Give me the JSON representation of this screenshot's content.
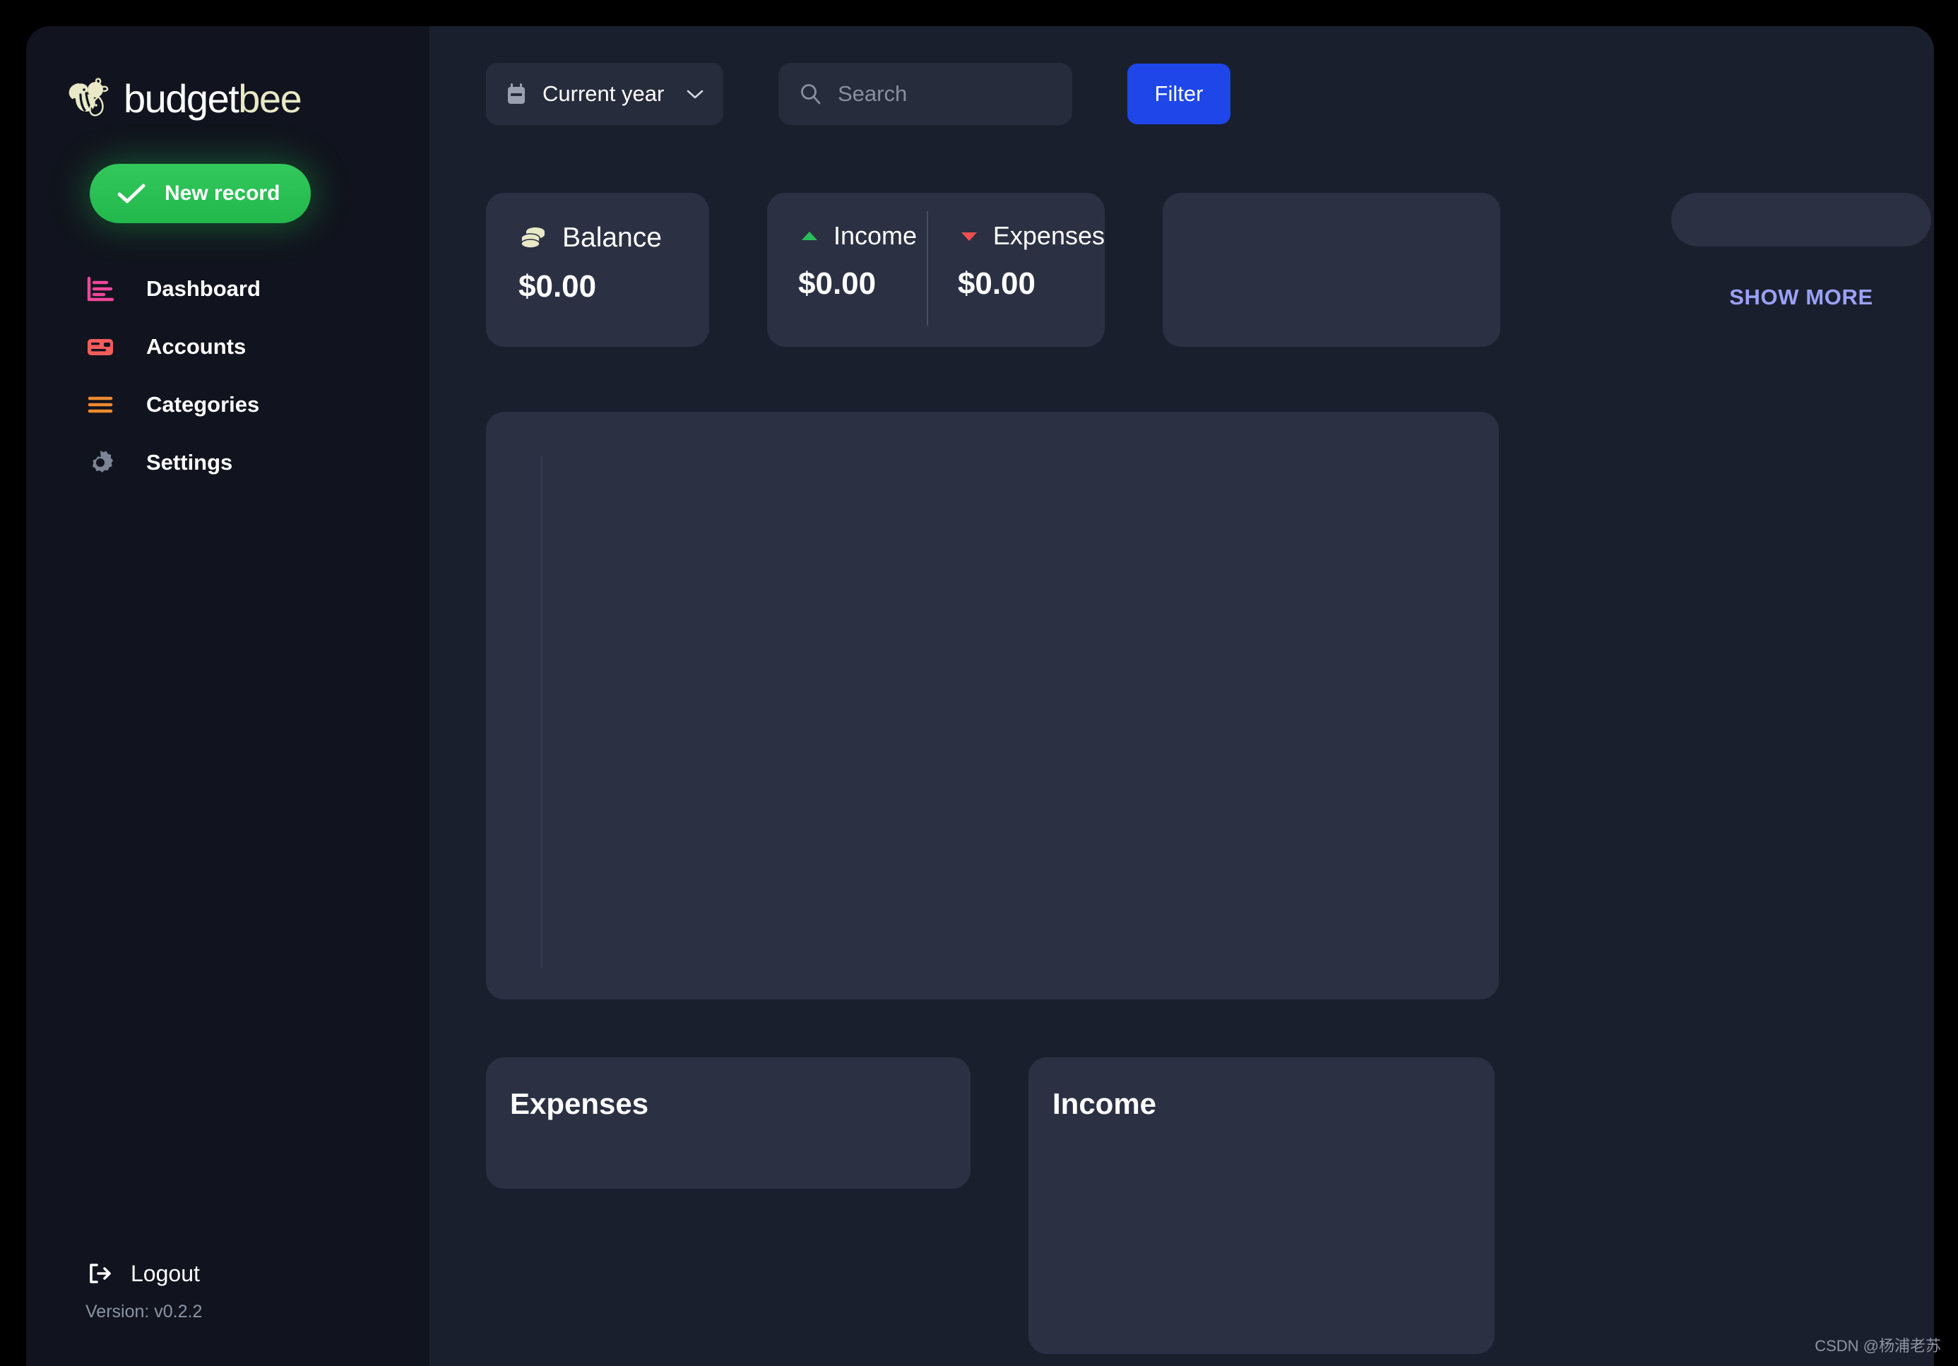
{
  "app": {
    "brand_first": "budget",
    "brand_second": "bee",
    "bee_icon": "bee-icon",
    "accent_green": "#22B84C",
    "accent_blue": "#1E46E8",
    "accent_lavender": "#9BA1F7",
    "brand_cream": "#E9E9C7",
    "background": "#1A1F2E",
    "sidebar_background": "#11141E",
    "card_background": "#2B3043"
  },
  "sidebar": {
    "new_record_label": "New record",
    "new_record_icon": "check-icon",
    "items": [
      {
        "label": "Dashboard",
        "icon": "bar-chart-icon",
        "color": "#F0479B"
      },
      {
        "label": "Accounts",
        "icon": "credit-card-icon",
        "color": "#F25C5C"
      },
      {
        "label": "Categories",
        "icon": "list-lines-icon",
        "color": "#F08A2E"
      },
      {
        "label": "Settings",
        "icon": "gear-icon",
        "color": "#7C8496"
      }
    ],
    "logout_label": "Logout",
    "logout_icon": "logout-icon",
    "version_label": "Version: v0.2.2"
  },
  "toolbar": {
    "period_value": "Current year",
    "period_icon": "calendar-icon",
    "period_chevron": "chevron-down-icon",
    "search_placeholder": "Search",
    "search_value": "",
    "search_icon": "search-icon",
    "filter_label": "Filter"
  },
  "stats": {
    "balance": {
      "title": "Balance",
      "icon": "coins-icon",
      "amount": "$0.00"
    },
    "income": {
      "title": "Income",
      "icon": "triangle-up-icon",
      "icon_color": "#2BBD5B",
      "amount": "$0.00"
    },
    "expenses": {
      "title": "Expenses",
      "icon": "triangle-down-icon",
      "icon_color": "#F04F4F",
      "amount": "$0.00"
    },
    "show_more_label": "SHOW MORE"
  },
  "sections": {
    "expenses_title": "Expenses",
    "income_title": "Income"
  },
  "watermark": "CSDN @杨浦老苏"
}
